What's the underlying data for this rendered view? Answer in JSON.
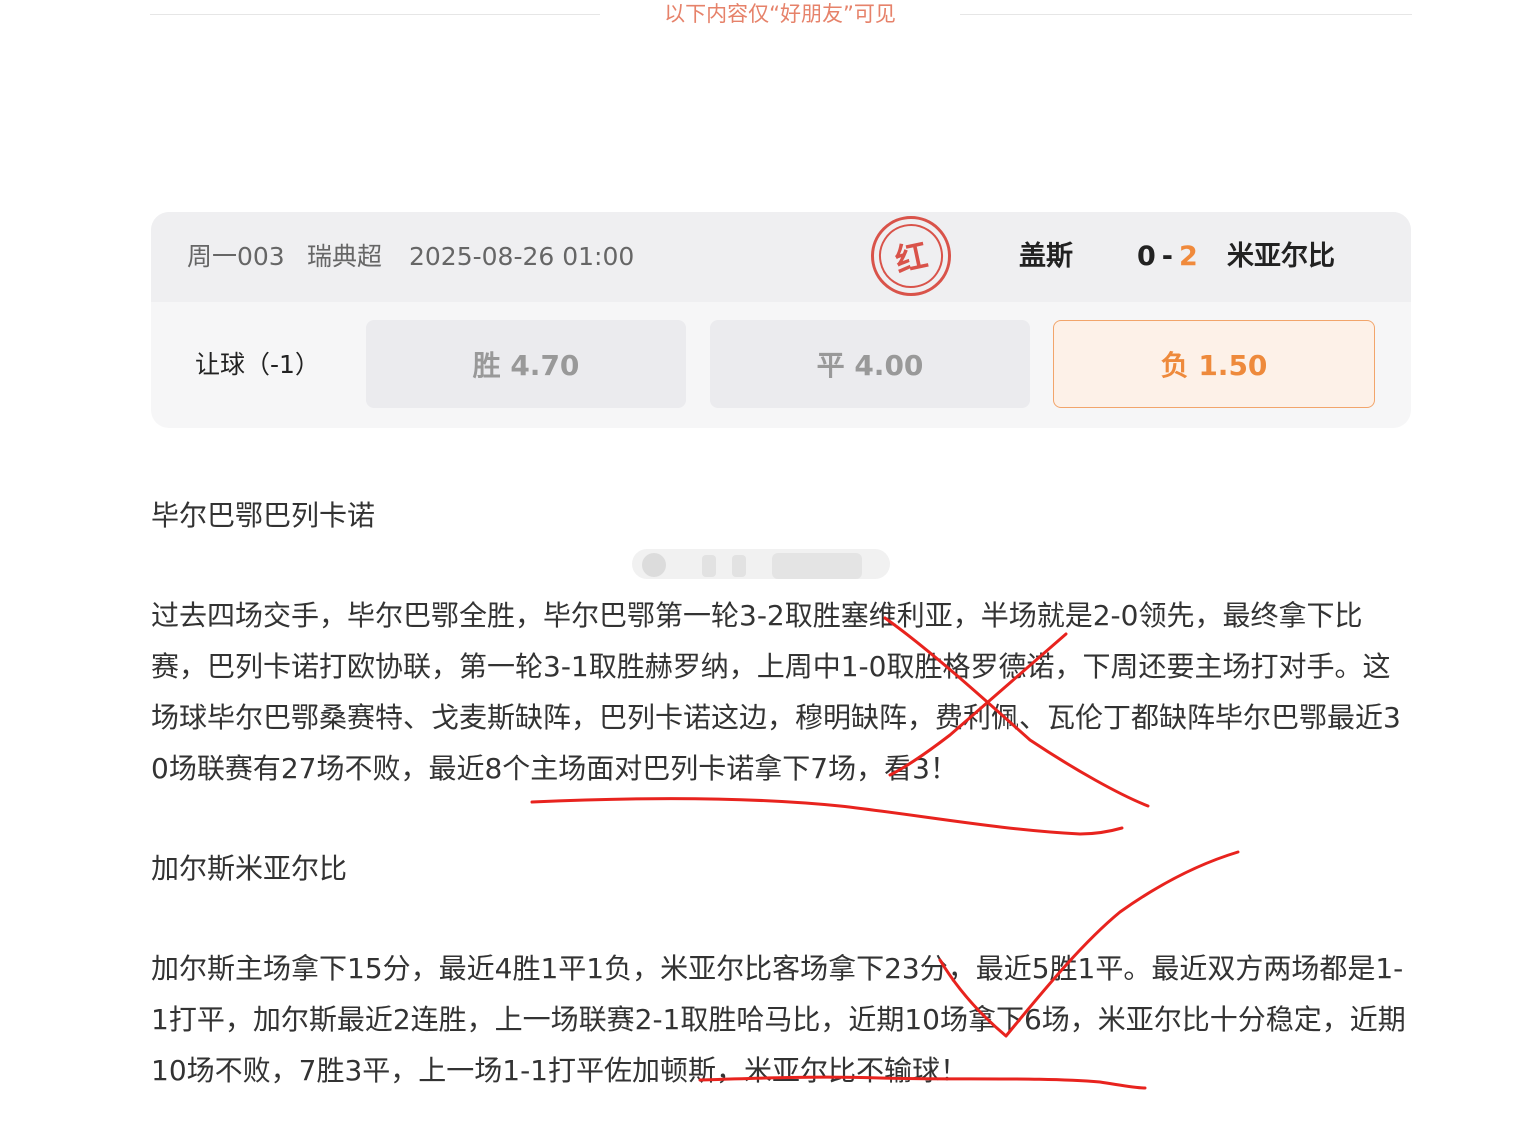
{
  "notice": {
    "text": "以下内容仅“好朋友”可见"
  },
  "match": {
    "code": "周一003",
    "league": "瑞典超",
    "datetime": "2025-08-26 01:00",
    "result_stamp": "红",
    "home_team": "盖斯",
    "home_score": "0",
    "score_sep": "-",
    "away_score": "2",
    "away_team": "米亚尔比",
    "handicap_label": "让球（-1）",
    "odds": [
      {
        "label": "胜 4.70",
        "selected": false
      },
      {
        "label": "平 4.00",
        "selected": false
      },
      {
        "label": "负 1.50",
        "selected": true
      }
    ],
    "accent_color": "#f08a3c",
    "stamp_color": "#d9534a"
  },
  "article": {
    "section1_title": "毕尔巴鄂巴列卡诺",
    "section1_body": "过去四场交手，毕尔巴鄂全胜，毕尔巴鄂第一轮3-2取胜塞维利亚，半场就是2-0领先，最终拿下比赛，巴列卡诺打欧协联，第一轮3-1取胜赫罗纳，上周中1-0取胜格罗德诺，下周还要主场打对手。这场球毕尔巴鄂桑赛特、戈麦斯缺阵，巴列卡诺这边，穆明缺阵，费利佩、瓦伦丁都缺阵毕尔巴鄂最近30场联赛有27场不败，最近8个主场面对巴列卡诺拿下7场，看3！",
    "section2_title": "加尔斯米亚尔比",
    "section2_body": "加尔斯主场拿下15分，最近4胜1平1负，米亚尔比客场拿下23分，最近5胜1平。最近双方两场都是1-1打平，加尔斯最近2连胜，上一场联赛2-1取胜哈马比，近期10场拿下6场，米亚尔比十分稳定，近期10场不败，7胜3平，上一场1-1打平佐加顿斯，米亚尔比不输球！"
  },
  "annotations": {
    "ink_color": "#e8231e",
    "marks": [
      "cross",
      "underline",
      "checkmark",
      "underline"
    ]
  }
}
